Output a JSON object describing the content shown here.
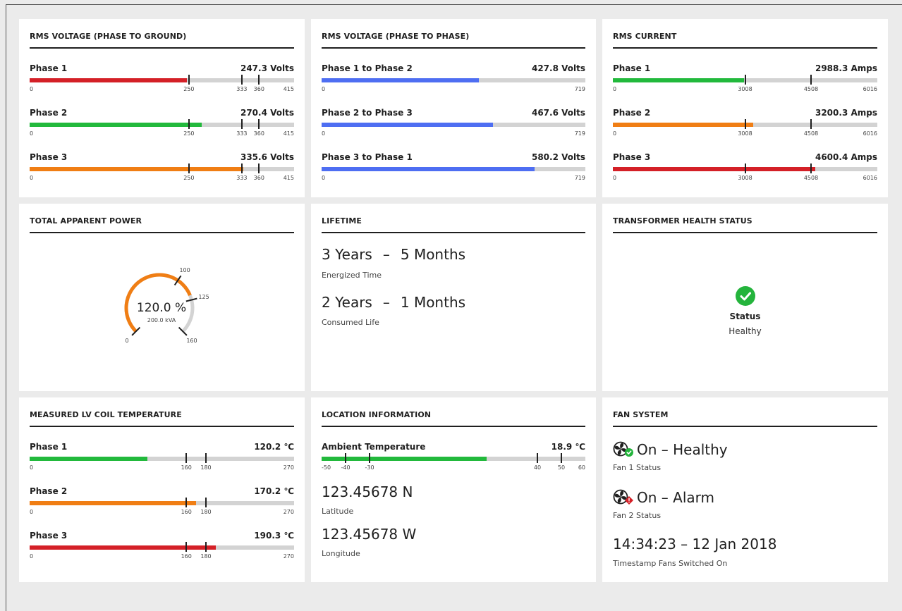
{
  "colors": {
    "red": "#d42027",
    "green": "#22b93c",
    "orange": "#f07e14",
    "blue": "#4e6ef2",
    "track": "#d3d3d3"
  },
  "phase_ground": {
    "title": "RMS VOLTAGE (PHASE TO GROUND)",
    "max": 415,
    "rows": [
      {
        "label": "Phase 1",
        "value": "247.3 Volts",
        "level": 247.3,
        "color": "red",
        "ticks": [
          {
            "v": 250,
            "t": "250"
          },
          {
            "v": 333,
            "t": "333"
          },
          {
            "v": 360,
            "t": "360"
          }
        ],
        "min_label": "0",
        "max_label": "415"
      },
      {
        "label": "Phase 2",
        "value": "270.4 Volts",
        "level": 270.4,
        "color": "green",
        "ticks": [
          {
            "v": 250,
            "t": "250"
          },
          {
            "v": 333,
            "t": "333"
          },
          {
            "v": 360,
            "t": "360"
          }
        ],
        "min_label": "0",
        "max_label": "415"
      },
      {
        "label": "Phase 3",
        "value": "335.6 Volts",
        "level": 335.6,
        "color": "orange",
        "ticks": [
          {
            "v": 250,
            "t": "250"
          },
          {
            "v": 333,
            "t": "333"
          },
          {
            "v": 360,
            "t": "360"
          }
        ],
        "min_label": "0",
        "max_label": "415"
      }
    ]
  },
  "phase_phase": {
    "title": "RMS VOLTAGE (PHASE TO PHASE)",
    "max": 719,
    "rows": [
      {
        "label": "Phase 1 to Phase 2",
        "value": "427.8 Volts",
        "level": 427.8,
        "color": "blue",
        "ticks": [],
        "min_label": "0",
        "max_label": "719"
      },
      {
        "label": "Phase 2 to Phase 3",
        "value": "467.6 Volts",
        "level": 467.6,
        "color": "blue",
        "ticks": [],
        "min_label": "0",
        "max_label": "719"
      },
      {
        "label": "Phase 3 to Phase 1",
        "value": "580.2 Volts",
        "level": 580.2,
        "color": "blue",
        "ticks": [],
        "min_label": "0",
        "max_label": "719"
      }
    ]
  },
  "rms_current": {
    "title": "RMS CURRENT",
    "max": 6016,
    "rows": [
      {
        "label": "Phase 1",
        "value": "2988.3 Amps",
        "level": 2988.3,
        "color": "green",
        "ticks": [
          {
            "v": 3008,
            "t": "3008"
          },
          {
            "v": 4508,
            "t": "4508"
          }
        ],
        "min_label": "0",
        "max_label": "6016"
      },
      {
        "label": "Phase 2",
        "value": "3200.3 Amps",
        "level": 3200.3,
        "color": "orange",
        "ticks": [
          {
            "v": 3008,
            "t": "3008"
          },
          {
            "v": 4508,
            "t": "4508"
          }
        ],
        "min_label": "0",
        "max_label": "6016"
      },
      {
        "label": "Phase 3",
        "value": "4600.4 Amps",
        "level": 4600.4,
        "color": "red",
        "ticks": [
          {
            "v": 3008,
            "t": "3008"
          },
          {
            "v": 4508,
            "t": "4508"
          }
        ],
        "min_label": "0",
        "max_label": "6016"
      }
    ]
  },
  "apparent_power": {
    "title": "TOTAL APPARENT POWER",
    "percent": "120.0 %",
    "kva": "200.0 kVA",
    "level": 120,
    "max": 160,
    "color": "orange",
    "ticks": [
      {
        "v": 0,
        "t": "0"
      },
      {
        "v": 100,
        "t": "100"
      },
      {
        "v": 125,
        "t": "125"
      },
      {
        "v": 160,
        "t": "160"
      }
    ]
  },
  "lifetime": {
    "title": "LIFETIME",
    "energized": {
      "years": "3 Years",
      "dash": "–",
      "months": "5 Months",
      "label": "Energized Time"
    },
    "consumed": {
      "years": "2 Years",
      "dash": "–",
      "months": "1 Months",
      "label": "Consumed Life"
    }
  },
  "health": {
    "title": "TRANSFORMER HEALTH STATUS",
    "icon": "check-circle-icon",
    "status_label": "Status",
    "status_value": "Healthy"
  },
  "lv_coil": {
    "title": "MEASURED LV COIL TEMPERATURE",
    "max": 270,
    "rows": [
      {
        "label": "Phase 1",
        "value": "120.2 ℃",
        "level": 120.2,
        "color": "green",
        "ticks": [
          {
            "v": 160,
            "t": "160"
          },
          {
            "v": 180,
            "t": "180"
          }
        ],
        "min_label": "0",
        "max_label": "270"
      },
      {
        "label": "Phase 2",
        "value": "170.2 ℃",
        "level": 170.2,
        "color": "orange",
        "ticks": [
          {
            "v": 160,
            "t": "160"
          },
          {
            "v": 180,
            "t": "180"
          }
        ],
        "min_label": "0",
        "max_label": "270"
      },
      {
        "label": "Phase 3",
        "value": "190.3 ℃",
        "level": 190.3,
        "color": "red",
        "ticks": [
          {
            "v": 160,
            "t": "160"
          },
          {
            "v": 180,
            "t": "180"
          }
        ],
        "min_label": "0",
        "max_label": "270"
      }
    ]
  },
  "location": {
    "title": "LOCATION INFORMATION",
    "ambient": {
      "label": "Ambient Temperature",
      "value": "18.9 ℃",
      "level": 18.9,
      "min": -50,
      "max": 60,
      "color": "green",
      "ticks": [
        {
          "v": -40
        },
        {
          "v": -30
        },
        {
          "v": 40
        },
        {
          "v": 50
        }
      ],
      "tick_labels": [
        {
          "v": -50,
          "t": "-50"
        },
        {
          "v": -40,
          "t": "-40"
        },
        {
          "v": -30,
          "t": "-30"
        },
        {
          "v": 40,
          "t": "40"
        },
        {
          "v": 50,
          "t": "50"
        },
        {
          "v": 60,
          "t": "60"
        }
      ]
    },
    "latitude": {
      "value": "123.45678 N",
      "label": "Latitude"
    },
    "longitude": {
      "value": "123.45678 W",
      "label": "Longitude"
    }
  },
  "fan": {
    "title": "FAN SYSTEM",
    "fan1": {
      "icon": "fan-icon",
      "badge": "check-badge-icon",
      "text": "On – Healthy",
      "label": "Fan 1 Status"
    },
    "fan2": {
      "icon": "fan-icon",
      "badge": "alarm-badge-icon",
      "text": "On – Alarm",
      "label": "Fan 2 Status"
    },
    "timestamp": {
      "value": "14:34:23 – 12 Jan 2018",
      "label": "Timestamp Fans Switched On"
    }
  }
}
